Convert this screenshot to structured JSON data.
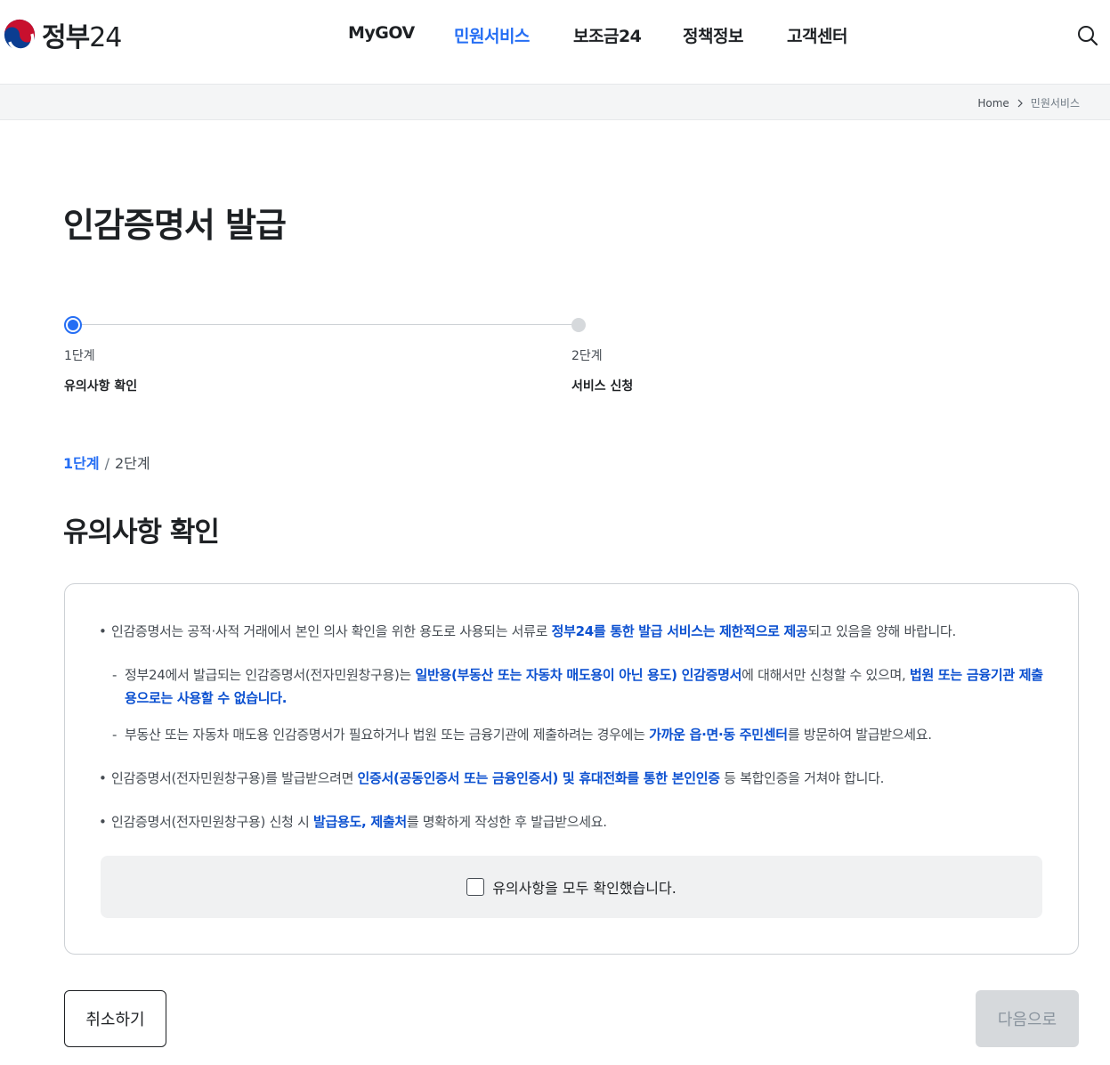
{
  "header": {
    "logo": {
      "text_kor": "정부",
      "text_num": "24",
      "icon": "taegeuk-logo-icon"
    },
    "nav": [
      {
        "label": "MyGOV",
        "active": false
      },
      {
        "label": "민원서비스",
        "active": true
      },
      {
        "label": "보조금24",
        "active": false
      },
      {
        "label": "정책정보",
        "active": false
      },
      {
        "label": "고객센터",
        "active": false
      }
    ],
    "search_icon": "search-icon"
  },
  "breadcrumb": {
    "home": "Home",
    "current": "민원서비스",
    "separator_icon": "chevron-right-icon"
  },
  "page": {
    "title": "인감증명서 발급"
  },
  "stepper": {
    "steps": [
      {
        "num": "1단계",
        "label": "유의사항 확인",
        "active": true
      },
      {
        "num": "2단계",
        "label": "서비스 신청",
        "active": false
      }
    ]
  },
  "step_indicator": {
    "current": "1단계",
    "separator": "/",
    "next": "2단계"
  },
  "section": {
    "title": "유의사항 확인"
  },
  "notices": {
    "n1": {
      "t1": "인감증명서는 공적·사적 거래에서 본인 의사 확인을 위한 용도로 사용되는 서류로 ",
      "h1": "정부24를 통한 발급 서비스는 제한적으로 제공",
      "t2": "되고 있음을 양해 바랍니다."
    },
    "n2": {
      "t1": "정부24에서 발급되는 인감증명서(전자민원창구용)는 ",
      "h1": "일반용(부동산 또는 자동차 매도용이 아닌 용도) 인감증명서",
      "t2": "에 대해서만 신청할 수 있으며, ",
      "h2": "법원 또는 금융기관 제출용으로는 사용할 수 없습니다."
    },
    "n3": {
      "t1": "부동산 또는 자동차 매도용 인감증명서가 필요하거나 법원 또는 금융기관에 제출하려는 경우에는 ",
      "h1": "가까운 읍·면·동 주민센터",
      "t2": "를 방문하여 발급받으세요."
    },
    "n4": {
      "t1": "인감증명서(전자민원창구용)를 발급받으려면 ",
      "h1": "인증서(공동인증서 또는 금융인증서) 및 휴대전화를 통한 본인인증",
      "t2": " 등 복합인증을 거쳐야 합니다."
    },
    "n5": {
      "t1": "인감증명서(전자민원창구용) 신청 시 ",
      "h1": "발급용도, 제출처",
      "t2": "를 명확하게 작성한 후 발급받으세요."
    }
  },
  "confirm": {
    "label": "유의사항을 모두 확인했습니다.",
    "checked": false
  },
  "buttons": {
    "cancel": "취소하기",
    "next": "다음으로"
  },
  "colors": {
    "accent": "#256ef4",
    "highlight": "#0b50d0",
    "disabled_bg": "#d6d9dc"
  }
}
